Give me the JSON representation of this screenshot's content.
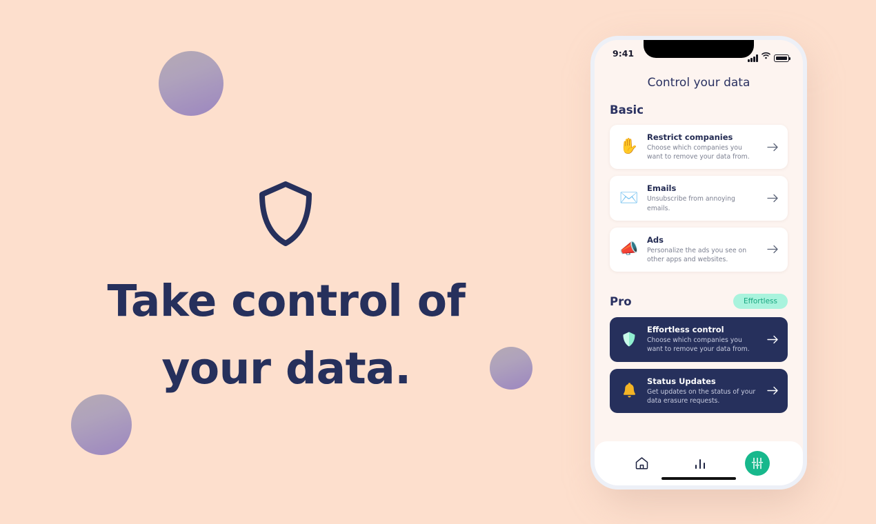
{
  "theme": {
    "page_background": "#FDDFCD",
    "ink_navy": "#26305C",
    "accent_mint": "#A9F3DD",
    "accent_green": "#17B88C",
    "card_white": "#FFFFFF"
  },
  "hero": {
    "logo_icon": "shield-icon",
    "heading_line_1": "Take control of",
    "heading_line_2": "your data."
  },
  "decorations": [
    {
      "name": "gradient-circle-top",
      "gradient_from": "#B5AAB4",
      "gradient_to": "#9C86C0"
    },
    {
      "name": "gradient-circle-middle",
      "gradient_from": "#B5AAB4",
      "gradient_to": "#9C86C0"
    },
    {
      "name": "gradient-circle-bottom",
      "gradient_from": "#B5AAB4",
      "gradient_to": "#9C86C0"
    }
  ],
  "phone": {
    "status_bar": {
      "time": "9:41",
      "signal_icon": "cellular-signal-icon",
      "wifi_icon": "wifi-icon",
      "battery_icon": "battery-full-icon"
    },
    "screen_title": "Control your data",
    "sections": [
      {
        "label": "Basic",
        "badge": null,
        "cards": [
          {
            "icon": "raised-hand-icon",
            "emoji": "✋",
            "title": "Restrict companies",
            "description": "Choose which companies you want to remove your data from.",
            "arrow_icon": "arrow-right-icon",
            "style": "light"
          },
          {
            "icon": "envelope-icon",
            "emoji": "✉️",
            "title": "Emails",
            "description": "Unsubscribe from annoying emails.",
            "arrow_icon": "arrow-right-icon",
            "style": "light"
          },
          {
            "icon": "megaphone-icon",
            "emoji": "📣",
            "title": "Ads",
            "description": "Personalize the ads you see on other apps and websites.",
            "arrow_icon": "arrow-right-icon",
            "style": "light"
          }
        ]
      },
      {
        "label": "Pro",
        "badge": "Effortless",
        "cards": [
          {
            "icon": "shield-icon",
            "emoji": "🛡",
            "title": "Effortless control",
            "description": "Choose which companies you want to remove your data from.",
            "arrow_icon": "arrow-right-icon",
            "style": "dark"
          },
          {
            "icon": "bell-icon",
            "emoji": "🔔",
            "title": "Status Updates",
            "description": "Get updates on the status of your data erasure requests.",
            "arrow_icon": "arrow-right-icon",
            "style": "dark"
          }
        ]
      }
    ],
    "bottom_nav": {
      "items": [
        {
          "name": "home-icon",
          "label": "Home",
          "active": false
        },
        {
          "name": "bar-chart-icon",
          "label": "Stats",
          "active": false
        },
        {
          "name": "sliders-icon",
          "label": "Settings",
          "active": true
        }
      ],
      "home_indicator": true
    }
  }
}
